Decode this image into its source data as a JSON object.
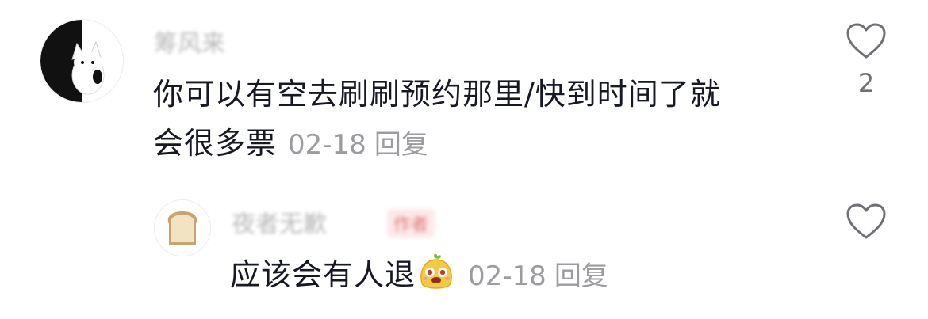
{
  "comments": [
    {
      "username": "筹风来",
      "text_line1": "你可以有空去刷刷预约那里/快到时间了就",
      "text_line2": "会很多票",
      "date": "02-18",
      "reply_label": "回复",
      "like_count": "2",
      "avatar_icon": "cat-avatar-icon",
      "like_icon": "heart-outline-icon"
    },
    {
      "username": "夜者无歉",
      "badge": "作者",
      "text": "应该会有人退",
      "emoji_icon": "smiling-mascot-emoji-icon",
      "date": "02-18",
      "reply_label": "回复",
      "avatar_icon": "toast-bread-icon",
      "like_icon": "heart-outline-icon"
    }
  ]
}
